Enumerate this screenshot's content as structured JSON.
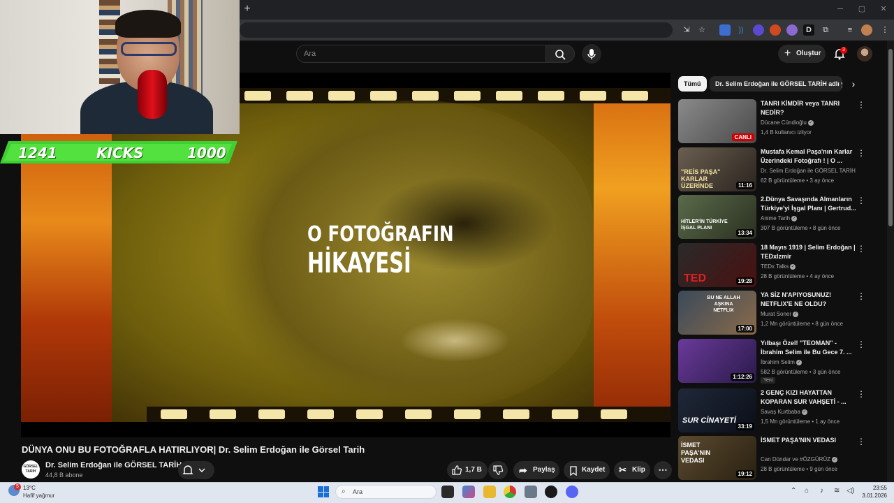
{
  "browser": {
    "new_tab": "+",
    "window_controls": [
      "─",
      "▢",
      "✕"
    ],
    "extensions": [
      "install-app-icon",
      "star-icon",
      "translate-icon",
      "audio-icon",
      "shield-icon",
      "fox-icon",
      "cloud-icon",
      "d-icon",
      "puzzle-icon",
      "reading-list-icon",
      "profile-icon",
      "menu-icon"
    ],
    "ext_d_label": "D"
  },
  "youtube": {
    "search_placeholder": "Ara",
    "create_label": "Oluştur",
    "notification_count": "3"
  },
  "overlay": {
    "kicks_left": "1241",
    "kicks_label": "KICKS",
    "kicks_right": "1000"
  },
  "player": {
    "frame_text_line1": "O FOTOĞRAFIN",
    "frame_text_line2": "HİKAYESİ"
  },
  "video": {
    "title": "DÜNYA ONU BU FOTOĞRAFLA HATIRLIYOR| Dr. Selim Erdoğan ile Görsel Tarih",
    "channel_name": "Dr. Selim Erdoğan ile GÖRSEL TARİH",
    "channel_avatar_text": "GÖRSEL TARİH",
    "subscribers": "44,8 B abone",
    "like_count": "1,7 B",
    "share_label": "Paylaş",
    "save_label": "Kaydet",
    "clip_label": "Klip"
  },
  "sidebar": {
    "chips": [
      "Tümü",
      "Dr. Selim Erdoğan ile GÖRSEL TARİH adlı yü"
    ],
    "recommendations": [
      {
        "title": "TANRI KİMDİR veya TANRI NEDİR?",
        "channel": "Dücane Cündioğlu",
        "meta": "1,4 B kullanıcı izliyor",
        "badge": "CANLI",
        "live": true,
        "color": "#6a6a6a"
      },
      {
        "title": "Mustafa Kemal Paşa'nın Karlar Üzerindeki Fotoğrafı ! | O ...",
        "channel": "Dr. Selim Erdoğan ile GÖRSEL TARİH",
        "meta": "62 B görüntüleme • 3 ay önce",
        "duration": "11:16",
        "thumb_text": "\"REİS PAŞA\" KARLAR ÜZERİNDE",
        "color": "#5a5248"
      },
      {
        "title": "2.Dünya Savaşında Almanların Türkiye'yi İşgal Planı | Gertrud...",
        "channel": "Anime Tarih",
        "meta": "307 B görüntüleme • 8 gün önce",
        "duration": "13:34",
        "thumb_text": "HİTLER'İN TÜRKİYE İŞGAL PLANI",
        "color": "#4a5a3a"
      },
      {
        "title": "18 Mayıs 1919 | Selim Erdoğan | TEDxIzmir",
        "channel": "TEDx Talks",
        "meta": "28 B görüntüleme • 4 ay önce",
        "duration": "19:28",
        "thumb_text": "TED",
        "color": "#3a1a1a"
      },
      {
        "title": "YA SİZ N'APIYOSUNUZ! NETFLIX'E NE OLDU?",
        "channel": "Murat Soner",
        "meta": "1,2 Mn görüntüleme • 8 gün önce",
        "duration": "17:00",
        "thumb_text": "BU NE ALLAH AŞKINA NETFLIX",
        "color": "#2a3a4a"
      },
      {
        "title": "Yılbaşı Özel! \"TEOMAN\" - İbrahim Selim ile Bu Gece 7. ...",
        "channel": "İbrahim Selim",
        "meta": "582 B görüntüleme • 3 gün önce",
        "badge_text": "Yeni",
        "duration": "1:12:26",
        "color": "#4a2a6a"
      },
      {
        "title": "2 GENÇ KIZI HAYATTAN KOPARAN SUR VAHŞETİ - ...",
        "channel": "Savaş Kurtbaba",
        "meta": "1,5 Mn görüntüleme • 1 ay önce",
        "duration": "33:19",
        "thumb_text": "SUR CİNAYETİ",
        "color": "#1a2030"
      },
      {
        "title": "İSMET PAŞA'NIN VEDASI",
        "channel": "Can Dündar ve #ÖZGÜRÜZ",
        "meta": "28 B görüntüleme • 9 gün önce",
        "duration": "19:12",
        "thumb_text": "İSMET PAŞA'NIN VEDASI",
        "color": "#3a3020"
      }
    ]
  },
  "taskbar": {
    "weather_badge": "5",
    "temperature": "13°C",
    "weather": "Hafif yağmur",
    "search_label": "Ara",
    "time": "23:55",
    "date": "3.01.2026"
  }
}
